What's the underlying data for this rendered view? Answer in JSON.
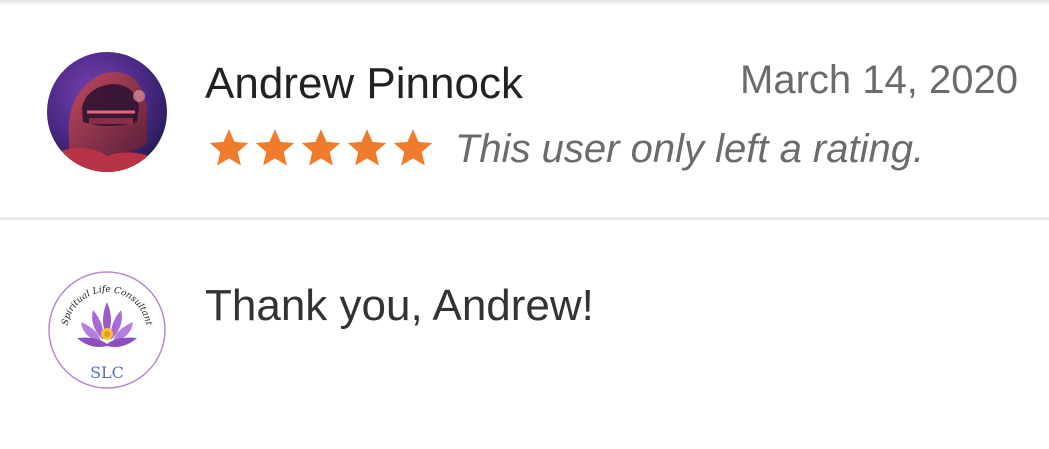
{
  "review": {
    "reviewer_name": "Andrew Pinnock",
    "date": "March 14, 2020",
    "rating": 5,
    "rating_max": 5,
    "text": "This user only left a rating.",
    "star_color": "#f07b2a",
    "avatar_icon": "user-avatar-icon"
  },
  "reply": {
    "text": "Thank you, Andrew!",
    "avatar_icon": "business-logo-icon",
    "logo_text_top": "Spiritual Life Consultant",
    "logo_text_bottom": "SLC"
  }
}
